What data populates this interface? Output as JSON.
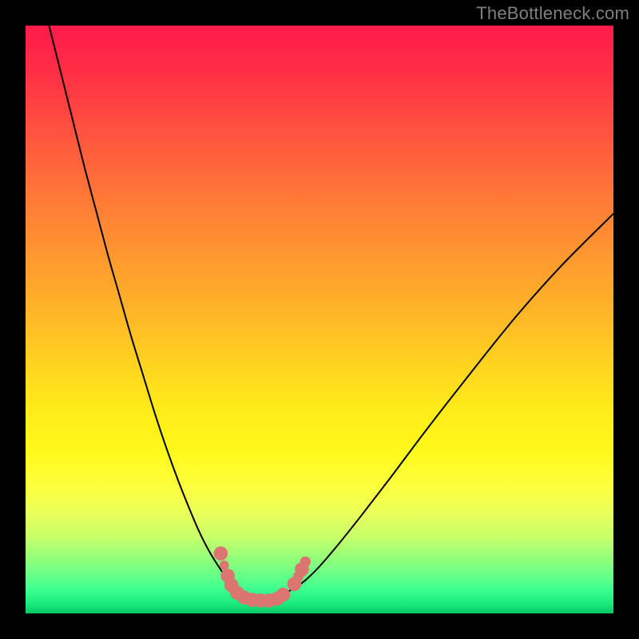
{
  "watermark": "TheBottleneck.com",
  "chart_data": {
    "type": "line",
    "title": "",
    "xlabel": "",
    "ylabel": "",
    "xlim": [
      0,
      100
    ],
    "ylim": [
      0,
      100
    ],
    "grid": false,
    "series": [
      {
        "name": "curve-left",
        "stroke": "#000000",
        "x": [
          4,
          6,
          8,
          10,
          12,
          14,
          16,
          18,
          20,
          22,
          24,
          26,
          28,
          29.5,
          31,
          32.5,
          34,
          35,
          36,
          37
        ],
        "y": [
          100,
          92,
          84,
          76,
          68.5,
          61,
          54,
          47,
          40.5,
          34,
          28,
          22.5,
          17.5,
          14,
          11,
          8.5,
          6.3,
          5.0,
          4.0,
          3.4
        ]
      },
      {
        "name": "curve-right",
        "stroke": "#000000",
        "x": [
          44,
          45,
          46.5,
          48,
          50,
          53,
          57,
          62,
          68,
          75,
          83,
          91,
          100
        ],
        "y": [
          3.4,
          3.9,
          4.8,
          6.0,
          8.0,
          11.5,
          16.5,
          23,
          31,
          40,
          50,
          59,
          68
        ]
      },
      {
        "name": "markers",
        "stroke": "#da766f",
        "points": [
          {
            "x": 33.2,
            "y": 10.2,
            "r": 1.2
          },
          {
            "x": 33.8,
            "y": 8.2,
            "r": 0.8
          },
          {
            "x": 34.4,
            "y": 6.4,
            "r": 1.2
          },
          {
            "x": 35.0,
            "y": 4.8,
            "r": 1.2
          },
          {
            "x": 36.0,
            "y": 3.5,
            "r": 1.2
          },
          {
            "x": 37.2,
            "y": 2.7,
            "r": 1.2
          },
          {
            "x": 38.6,
            "y": 2.3,
            "r": 1.2
          },
          {
            "x": 40.0,
            "y": 2.2,
            "r": 1.2
          },
          {
            "x": 41.4,
            "y": 2.2,
            "r": 1.2
          },
          {
            "x": 42.8,
            "y": 2.5,
            "r": 1.2
          },
          {
            "x": 43.8,
            "y": 3.2,
            "r": 1.2
          },
          {
            "x": 45.7,
            "y": 5.0,
            "r": 1.2
          },
          {
            "x": 46.4,
            "y": 6.3,
            "r": 0.9
          },
          {
            "x": 47.0,
            "y": 7.5,
            "r": 1.2
          },
          {
            "x": 47.6,
            "y": 8.8,
            "r": 0.9
          }
        ]
      }
    ],
    "gradient_stops": [
      {
        "pos": 0.0,
        "color": "#ff1a4a"
      },
      {
        "pos": 0.5,
        "color": "#ffb927"
      },
      {
        "pos": 0.78,
        "color": "#fdff3a"
      },
      {
        "pos": 1.0,
        "color": "#0cc565"
      }
    ]
  }
}
